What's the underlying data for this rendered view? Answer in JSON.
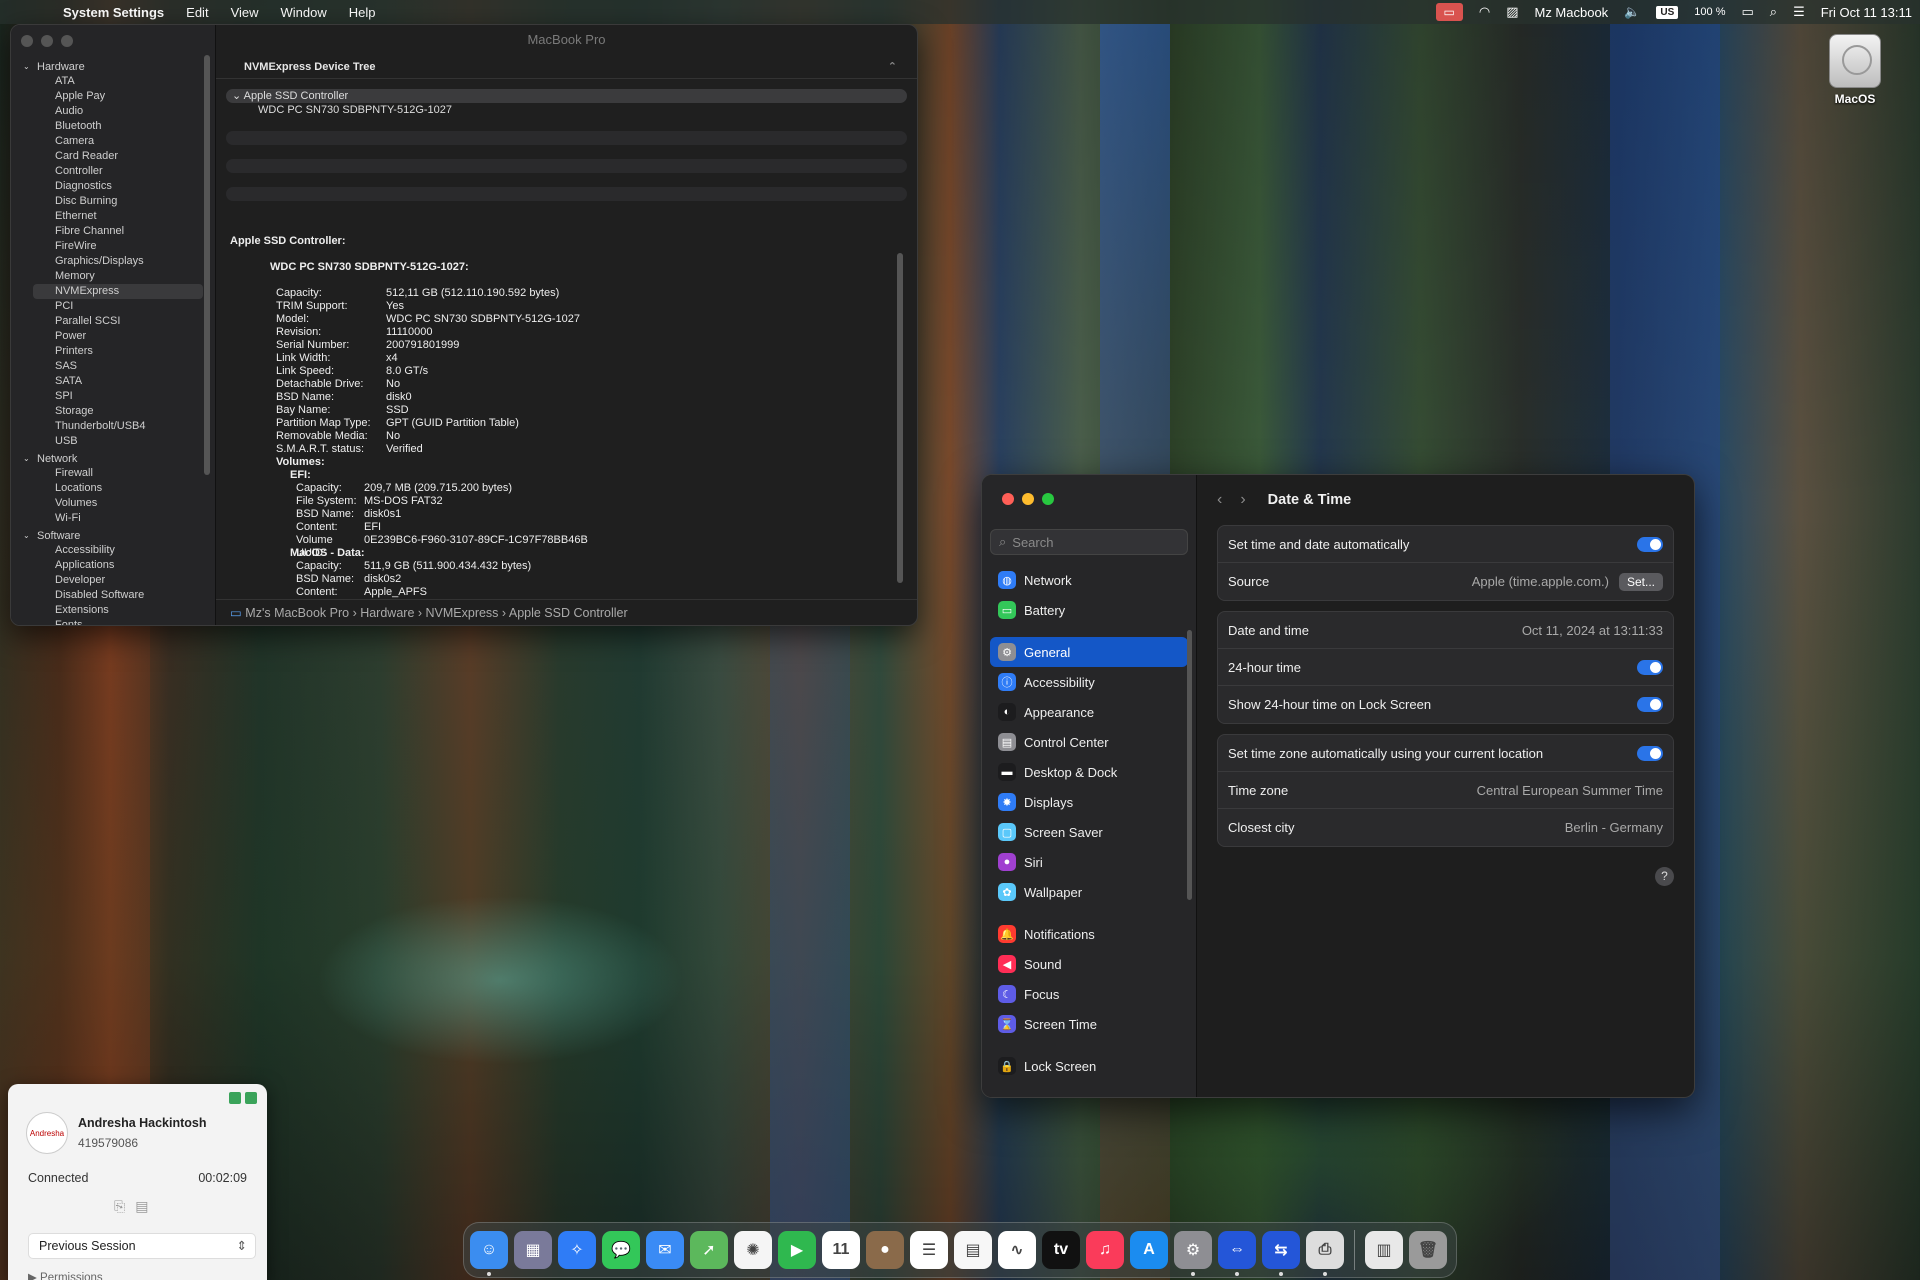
{
  "menubar": {
    "app_name": "System Settings",
    "menus": [
      "Edit",
      "View",
      "Window",
      "Help"
    ],
    "computer_name": "Mz Macbook",
    "input_source": "US",
    "battery": "100 %",
    "clock": "Fri Oct 11  13:11"
  },
  "desktop": {
    "disk_label": "MacOS"
  },
  "sysinfo": {
    "window_title": "MacBook Pro",
    "sidebar": {
      "hardware_label": "Hardware",
      "hardware_items": [
        "ATA",
        "Apple Pay",
        "Audio",
        "Bluetooth",
        "Camera",
        "Card Reader",
        "Controller",
        "Diagnostics",
        "Disc Burning",
        "Ethernet",
        "Fibre Channel",
        "FireWire",
        "Graphics/Displays",
        "Memory",
        "NVMExpress",
        "PCI",
        "Parallel SCSI",
        "Power",
        "Printers",
        "SAS",
        "SATA",
        "SPI",
        "Storage",
        "Thunderbolt/USB4",
        "USB"
      ],
      "selected_item": "NVMExpress",
      "network_label": "Network",
      "network_items": [
        "Firewall",
        "Locations",
        "Volumes",
        "Wi-Fi"
      ],
      "software_label": "Software",
      "software_items": [
        "Accessibility",
        "Applications",
        "Developer",
        "Disabled Software",
        "Extensions",
        "Fonts"
      ]
    },
    "tree_header": "NVMExpress Device Tree",
    "tree_parent": "Apple SSD Controller",
    "tree_child": "WDC PC SN730 SDBPNTY-512G-1027",
    "details": {
      "heading": "Apple SSD Controller:",
      "device_heading": "WDC PC SN730 SDBPNTY-512G-1027:",
      "fields": [
        {
          "k": "Capacity:",
          "v": "512,11 GB (512.110.190.592 bytes)"
        },
        {
          "k": "TRIM Support:",
          "v": "Yes"
        },
        {
          "k": "Model:",
          "v": "WDC PC SN730 SDBPNTY-512G-1027"
        },
        {
          "k": "Revision:",
          "v": "11110000"
        },
        {
          "k": "Serial Number:",
          "v": "200791801999"
        },
        {
          "k": "Link Width:",
          "v": "x4"
        },
        {
          "k": "Link Speed:",
          "v": "8.0 GT/s"
        },
        {
          "k": "Detachable Drive:",
          "v": "No"
        },
        {
          "k": "BSD Name:",
          "v": "disk0"
        },
        {
          "k": "Bay Name:",
          "v": "SSD"
        },
        {
          "k": "Partition Map Type:",
          "v": "GPT (GUID Partition Table)"
        },
        {
          "k": "Removable Media:",
          "v": "No"
        },
        {
          "k": "S.M.A.R.T. status:",
          "v": "Verified"
        }
      ],
      "volumes_label": "Volumes:",
      "efi_label": "EFI:",
      "efi_fields": [
        {
          "k": "Capacity:",
          "v": "209,7 MB (209.715.200 bytes)"
        },
        {
          "k": "File System:",
          "v": "MS-DOS FAT32"
        },
        {
          "k": "BSD Name:",
          "v": "disk0s1"
        },
        {
          "k": "Content:",
          "v": "EFI"
        },
        {
          "k": "Volume UUID:",
          "v": "0E239BC6-F960-3107-89CF-1C97F78BB46B"
        }
      ],
      "macos_label": "MacOS - Data:",
      "macos_fields": [
        {
          "k": "Capacity:",
          "v": "511,9 GB (511.900.434.432 bytes)"
        },
        {
          "k": "BSD Name:",
          "v": "disk0s2"
        },
        {
          "k": "Content:",
          "v": "Apple_APFS"
        }
      ]
    },
    "path": "Mz's MacBook Pro  ›  Hardware  ›  NVMExpress  ›  Apple SSD Controller"
  },
  "settings": {
    "search_placeholder": "Search",
    "sidebar_groups": [
      [
        {
          "label": "Network",
          "icon": "globe-icon",
          "color": "#2f7cf6",
          "glyph": "◍"
        },
        {
          "label": "Battery",
          "icon": "battery-icon",
          "color": "#33c759",
          "glyph": "▭"
        }
      ],
      [
        {
          "label": "General",
          "icon": "gear-icon",
          "color": "#8e8e93",
          "glyph": "⚙",
          "selected": true
        },
        {
          "label": "Accessibility",
          "icon": "accessibility-icon",
          "color": "#2f7cf6",
          "glyph": "ⓘ"
        },
        {
          "label": "Appearance",
          "icon": "appearance-icon",
          "color": "#1c1c1e",
          "glyph": "◐"
        },
        {
          "label": "Control Center",
          "icon": "control-center-icon",
          "color": "#8e8e93",
          "glyph": "▤"
        },
        {
          "label": "Desktop & Dock",
          "icon": "dock-icon",
          "color": "#1c1c1e",
          "glyph": "▬"
        },
        {
          "label": "Displays",
          "icon": "displays-icon",
          "color": "#2f7cf6",
          "glyph": "✸"
        },
        {
          "label": "Screen Saver",
          "icon": "screen-saver-icon",
          "color": "#5ac8fa",
          "glyph": "▢"
        },
        {
          "label": "Siri",
          "icon": "siri-icon",
          "color": "#a040d0",
          "glyph": "●"
        },
        {
          "label": "Wallpaper",
          "icon": "wallpaper-icon",
          "color": "#5ac8fa",
          "glyph": "✿"
        }
      ],
      [
        {
          "label": "Notifications",
          "icon": "notifications-icon",
          "color": "#ff3b30",
          "glyph": "🔔"
        },
        {
          "label": "Sound",
          "icon": "sound-icon",
          "color": "#ff2d55",
          "glyph": "◀"
        },
        {
          "label": "Focus",
          "icon": "focus-icon",
          "color": "#5e5ce6",
          "glyph": "☾"
        },
        {
          "label": "Screen Time",
          "icon": "hourglass-icon",
          "color": "#5e5ce6",
          "glyph": "⌛"
        }
      ],
      [
        {
          "label": "Lock Screen",
          "icon": "lock-icon",
          "color": "#1c1c1e",
          "glyph": "🔒"
        }
      ]
    ],
    "page_title": "Date & Time",
    "set_auto_label": "Set time and date automatically",
    "source_label": "Source",
    "source_value": "Apple (time.apple.com.)",
    "set_button": "Set...",
    "date_time_label": "Date and time",
    "date_time_value": "Oct 11, 2024 at 13:11:33",
    "hour24_label": "24-hour time",
    "hour24_lock_label": "Show 24-hour time on Lock Screen",
    "tz_auto_label": "Set time zone automatically using your current location",
    "tz_label": "Time zone",
    "tz_value": "Central European Summer Time",
    "city_label": "Closest city",
    "city_value": "Berlin - Germany",
    "help_glyph": "?"
  },
  "session": {
    "name": "Andresha Hackintosh",
    "id": "419579086",
    "status": "Connected",
    "duration": "00:02:09",
    "select_value": "Previous Session",
    "permissions": "Permissions"
  },
  "dock": {
    "apps": [
      {
        "name": "finder-icon",
        "color": "#3b8df0",
        "glyph": "☺"
      },
      {
        "name": "launchpad-icon",
        "color": "#7a7a9a",
        "glyph": "▦"
      },
      {
        "name": "safari-icon",
        "color": "#2f7cf6",
        "glyph": "✧"
      },
      {
        "name": "messages-icon",
        "color": "#33c759",
        "glyph": "💬"
      },
      {
        "name": "mail-icon",
        "color": "#3a8bf5",
        "glyph": "✉"
      },
      {
        "name": "maps-icon",
        "color": "#5cb85c",
        "glyph": "➚"
      },
      {
        "name": "photos-icon",
        "color": "#f5f5f5",
        "glyph": "✺"
      },
      {
        "name": "facetime-icon",
        "color": "#2fb84f",
        "glyph": "▶"
      },
      {
        "name": "calendar-icon",
        "color": "#ffffff",
        "glyph": "11"
      },
      {
        "name": "contacts-icon",
        "color": "#8a6a4a",
        "glyph": "●"
      },
      {
        "name": "reminders-icon",
        "color": "#ffffff",
        "glyph": "☰"
      },
      {
        "name": "notes-icon",
        "color": "#f7f7f7",
        "glyph": "▤"
      },
      {
        "name": "freeform-icon",
        "color": "#ffffff",
        "glyph": "∿"
      },
      {
        "name": "apple-tv-icon",
        "color": "#111111",
        "glyph": "tv"
      },
      {
        "name": "music-icon",
        "color": "#fa3b5a",
        "glyph": "♫"
      },
      {
        "name": "app-store-icon",
        "color": "#1b8cf0",
        "glyph": "A"
      },
      {
        "name": "system-settings-icon",
        "color": "#8e8e93",
        "glyph": "⚙"
      },
      {
        "name": "teamviewer-icon",
        "color": "#2456d8",
        "glyph": "⇔"
      },
      {
        "name": "remote-desktop-icon",
        "color": "#2456d8",
        "glyph": "⇆"
      },
      {
        "name": "printer-icon",
        "color": "#dddddd",
        "glyph": "⎙"
      }
    ],
    "right": [
      {
        "name": "document-icon",
        "color": "#e8e8e8",
        "glyph": "▥"
      },
      {
        "name": "trash-icon",
        "color": "#9a9a9a",
        "glyph": "🗑"
      }
    ]
  }
}
